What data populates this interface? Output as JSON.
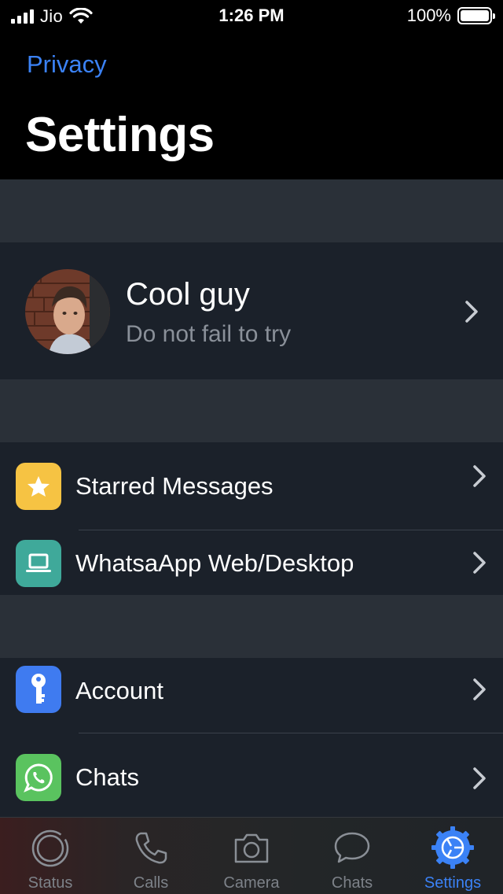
{
  "status_bar": {
    "carrier": "Jio",
    "time": "1:26 PM",
    "battery_percent": "100%"
  },
  "header": {
    "back_label": "Privacy",
    "title": "Settings"
  },
  "profile": {
    "name": "Cool guy",
    "status": "Do not fail to try"
  },
  "groups": [
    {
      "items": [
        {
          "label": "Starred Messages",
          "icon": "star-icon",
          "color": "#f6c343"
        },
        {
          "label": "WhatsaApp Web/Desktop",
          "icon": "laptop-icon",
          "color": "#3fa99a"
        }
      ]
    },
    {
      "items": [
        {
          "label": "Account",
          "icon": "key-icon",
          "color": "#3f7bf0"
        },
        {
          "label": "Chats",
          "icon": "whatsapp-icon",
          "color": "#5ac35f"
        }
      ]
    }
  ],
  "tabbar": {
    "tabs": [
      {
        "label": "Status",
        "icon": "status-icon"
      },
      {
        "label": "Calls",
        "icon": "phone-icon"
      },
      {
        "label": "Camera",
        "icon": "camera-icon"
      },
      {
        "label": "Chats",
        "icon": "chat-bubble-icon"
      },
      {
        "label": "Settings",
        "icon": "gear-icon",
        "active": true
      }
    ]
  },
  "colors": {
    "accent": "#3b82f6",
    "section_bg": "#1b212a",
    "gap_bg": "#2a3038"
  }
}
